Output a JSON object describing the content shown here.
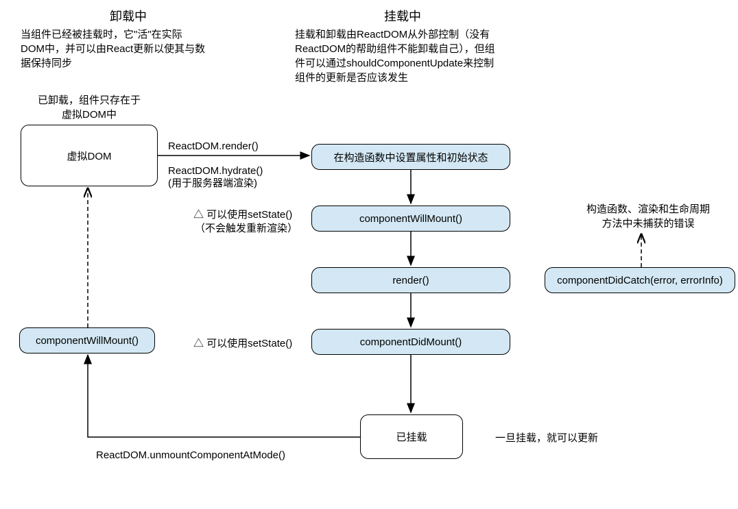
{
  "titles": {
    "unmounting": "卸载中",
    "mounting": "挂载中"
  },
  "descriptions": {
    "unmounting": "当组件已经被挂载时，它\"活\"在实际DOM中，并可以由React更新以使其与数据保持同步",
    "mounting": "挂载和卸载由ReactDOM从外部控制（没有ReactDOM的帮助组件不能卸载自己），但组件可以通过shouldComponentUpdate来控制组件的更新是否应该发生",
    "unloaded_note": "已卸载，组件只存在于虚拟DOM中",
    "error_note": "构造函数、渲染和生命周期方法中未捕获的错误"
  },
  "boxes": {
    "virtual_dom": "虚拟DOM",
    "constructor": "在构造函数中设置属性和初始状态",
    "component_will_mount": "componentWillMount()",
    "render": "render()",
    "component_did_mount": "componentDidMount()",
    "mounted": "已挂载",
    "component_will_unmount": "componentWillMount()",
    "component_did_catch": "componentDidCatch(error, errorInfo)"
  },
  "labels": {
    "reactdom_render": "ReactDOM.render()",
    "reactdom_hydrate": "ReactDOM.hydrate()",
    "hydrate_note": "(用于服务器端渲染)",
    "setstate_norender_1": "△ 可以使用setState()",
    "setstate_norender_2": "（不会触发重新渲染）",
    "setstate_can": "△ 可以使用setState()",
    "unmount_at_node": "ReactDOM.unmountComponentAtMode()",
    "once_mounted": "一旦挂载，就可以更新"
  }
}
